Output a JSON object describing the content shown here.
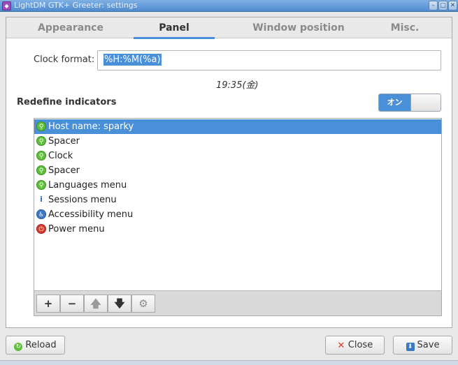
{
  "window": {
    "title": "LightDM GTK+ Greeter: settings",
    "icon": "app-icon",
    "controls": [
      "minimize-icon",
      "maximize-icon",
      "close-icon"
    ]
  },
  "tabs": [
    {
      "label": "Appearance",
      "active": false
    },
    {
      "label": "Panel",
      "active": true
    },
    {
      "label": "Window position",
      "active": false
    },
    {
      "label": "Misc.",
      "active": false
    }
  ],
  "clock": {
    "label": "Clock format:",
    "value": "%H:%M(%a)",
    "preview": "19:35(金)"
  },
  "indicators": {
    "title": "Redefine indicators",
    "switch_label": "オン",
    "switch_on": true,
    "items": [
      {
        "label": "Host name: sparky",
        "icon": "key-icon",
        "selected": true
      },
      {
        "label": "Spacer",
        "icon": "key-icon",
        "selected": false
      },
      {
        "label": "Clock",
        "icon": "key-icon",
        "selected": false
      },
      {
        "label": "Spacer",
        "icon": "key-icon",
        "selected": false
      },
      {
        "label": "Languages menu",
        "icon": "key-icon",
        "selected": false
      },
      {
        "label": "Sessions menu",
        "icon": "info-icon",
        "selected": false
      },
      {
        "label": "Accessibility menu",
        "icon": "accessibility-icon",
        "selected": false
      },
      {
        "label": "Power menu",
        "icon": "power-icon",
        "selected": false
      }
    ],
    "toolbar": {
      "add": "+",
      "remove": "−",
      "up": "🡅",
      "down": "🡇",
      "settings": "⚙"
    }
  },
  "buttons": {
    "reload": "Reload",
    "close": "Close",
    "save": "Save"
  },
  "colors": {
    "accent": "#4a90d9",
    "titlebar": "#5f99d8"
  }
}
